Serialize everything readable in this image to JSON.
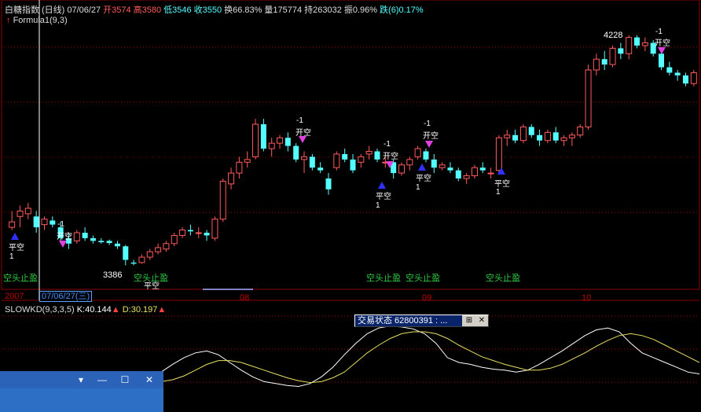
{
  "header": {
    "name": "白糖指数",
    "period": "(日线)",
    "date": "07/06/27",
    "open_label": "开",
    "open": "3574",
    "high_label": "高",
    "high": "3580",
    "low_label": "低",
    "low": "3546",
    "close_label": "收",
    "close": "3550",
    "turnover_label": "换",
    "turnover": "66.83%",
    "volume_label": "量",
    "volume": "175774",
    "oi_label": "持",
    "oi": "263032",
    "amp_label": "振",
    "amp": "0.96%",
    "chg_label": "跌(6)",
    "chg": "0.17%"
  },
  "formula": "Formula1(9,3)",
  "price_labels": {
    "high_mark": "4228",
    "low_mark": "3386"
  },
  "x_axis": {
    "labels": [
      "2007",
      "08",
      "09",
      "10"
    ],
    "current_date": "07/06/27(三)"
  },
  "signals": [
    {
      "type": "open_short",
      "label": "开空",
      "value": "-1"
    },
    {
      "type": "open_short",
      "label": "开空",
      "value": "-1"
    },
    {
      "type": "open_short",
      "label": "开空",
      "value": "-1"
    },
    {
      "type": "open_short",
      "label": "开空",
      "value": "-1"
    },
    {
      "type": "open_short",
      "label": "开空",
      "value": "-1"
    },
    {
      "type": "close_short",
      "label": "平空",
      "value": "1"
    },
    {
      "type": "close_short",
      "label": "平空",
      "value": "1"
    },
    {
      "type": "close_short",
      "label": "平空",
      "value": "1"
    },
    {
      "type": "close_short",
      "label": "平空",
      "value": "1"
    },
    {
      "type": "close_short",
      "label": "平空",
      "value": "1"
    }
  ],
  "stop_labels": [
    "空头止盈",
    "空头止盈",
    "空头止盈",
    "空头止盈",
    "空头止盈",
    "空头止盈"
  ],
  "kd": {
    "title": "SLOWKD(9,3,3,5)",
    "k_label": "K:40.144",
    "d_label": "D:30.197"
  },
  "trade_panel": {
    "title": "交易状态 62800391 : ...",
    "pin": "⊞",
    "close": "✕"
  },
  "mini_window": {
    "buttons": [
      "▾",
      "—",
      "☐",
      "✕"
    ]
  },
  "colors": {
    "up": "#ff5a5a",
    "down": "#54ffff",
    "ma": "#ffffff",
    "k": "#ffffff",
    "d": "#e8e060",
    "grid": "#8b0000"
  },
  "chart_data": {
    "type": "candlestick",
    "y_range": [
      3300,
      4300
    ],
    "candles": [
      [
        3520,
        3580,
        3510,
        3540
      ],
      [
        3560,
        3600,
        3520,
        3580
      ],
      [
        3570,
        3610,
        3550,
        3590
      ],
      [
        3560,
        3580,
        3500,
        3520
      ],
      [
        3530,
        3560,
        3510,
        3550
      ],
      [
        3545,
        3560,
        3520,
        3530
      ],
      [
        3520,
        3540,
        3460,
        3480
      ],
      [
        3480,
        3500,
        3440,
        3460
      ],
      [
        3470,
        3510,
        3460,
        3500
      ],
      [
        3500,
        3520,
        3470,
        3480
      ],
      [
        3480,
        3490,
        3460,
        3470
      ],
      [
        3470,
        3480,
        3460,
        3465
      ],
      [
        3470,
        3475,
        3455,
        3462
      ],
      [
        3460,
        3470,
        3440,
        3450
      ],
      [
        3450,
        3455,
        3380,
        3400
      ],
      [
        3390,
        3400,
        3380,
        3386
      ],
      [
        3390,
        3420,
        3386,
        3410
      ],
      [
        3410,
        3440,
        3400,
        3430
      ],
      [
        3430,
        3460,
        3420,
        3445
      ],
      [
        3440,
        3470,
        3430,
        3460
      ],
      [
        3460,
        3500,
        3450,
        3490
      ],
      [
        3490,
        3520,
        3480,
        3510
      ],
      [
        3510,
        3530,
        3490,
        3505
      ],
      [
        3500,
        3520,
        3480,
        3500
      ],
      [
        3500,
        3510,
        3470,
        3490
      ],
      [
        3480,
        3560,
        3470,
        3550
      ],
      [
        3550,
        3700,
        3540,
        3690
      ],
      [
        3680,
        3740,
        3660,
        3720
      ],
      [
        3720,
        3780,
        3700,
        3760
      ],
      [
        3760,
        3800,
        3740,
        3770
      ],
      [
        3780,
        3920,
        3770,
        3900
      ],
      [
        3900,
        3920,
        3800,
        3810
      ],
      [
        3810,
        3850,
        3780,
        3830
      ],
      [
        3830,
        3860,
        3810,
        3850
      ],
      [
        3850,
        3870,
        3800,
        3820
      ],
      [
        3820,
        3830,
        3760,
        3770
      ],
      [
        3770,
        3800,
        3720,
        3780
      ],
      [
        3780,
        3790,
        3730,
        3740
      ],
      [
        3740,
        3760,
        3720,
        3730
      ],
      [
        3700,
        3720,
        3640,
        3660
      ],
      [
        3740,
        3800,
        3730,
        3790
      ],
      [
        3790,
        3810,
        3760,
        3770
      ],
      [
        3770,
        3790,
        3720,
        3730
      ],
      [
        3760,
        3790,
        3740,
        3780
      ],
      [
        3790,
        3820,
        3770,
        3800
      ],
      [
        3800,
        3810,
        3760,
        3770
      ],
      [
        3760,
        3780,
        3740,
        3760
      ],
      [
        3760,
        3770,
        3700,
        3720
      ],
      [
        3720,
        3760,
        3710,
        3750
      ],
      [
        3750,
        3780,
        3730,
        3770
      ],
      [
        3780,
        3820,
        3770,
        3810
      ],
      [
        3800,
        3810,
        3760,
        3770
      ],
      [
        3770,
        3790,
        3720,
        3740
      ],
      [
        3740,
        3760,
        3730,
        3750
      ],
      [
        3740,
        3760,
        3720,
        3730
      ],
      [
        3730,
        3740,
        3690,
        3700
      ],
      [
        3700,
        3720,
        3680,
        3710
      ],
      [
        3710,
        3750,
        3700,
        3740
      ],
      [
        3740,
        3760,
        3720,
        3730
      ],
      [
        3720,
        3740,
        3700,
        3720
      ],
      [
        3730,
        3860,
        3720,
        3850
      ],
      [
        3850,
        3880,
        3820,
        3860
      ],
      [
        3860,
        3880,
        3830,
        3840
      ],
      [
        3840,
        3900,
        3830,
        3890
      ],
      [
        3890,
        3900,
        3850,
        3860
      ],
      [
        3860,
        3880,
        3820,
        3840
      ],
      [
        3840,
        3880,
        3830,
        3870
      ],
      [
        3870,
        3890,
        3830,
        3840
      ],
      [
        3840,
        3860,
        3820,
        3850
      ],
      [
        3850,
        3870,
        3820,
        3860
      ],
      [
        3860,
        3900,
        3850,
        3890
      ],
      [
        3890,
        4120,
        3880,
        4100
      ],
      [
        4100,
        4160,
        4080,
        4140
      ],
      [
        4140,
        4170,
        4100,
        4120
      ],
      [
        4120,
        4190,
        4110,
        4180
      ],
      [
        4180,
        4200,
        4140,
        4160
      ],
      [
        4160,
        4228,
        4140,
        4220
      ],
      [
        4220,
        4228,
        4180,
        4190
      ],
      [
        4190,
        4220,
        4170,
        4200
      ],
      [
        4200,
        4210,
        4150,
        4160
      ],
      [
        4160,
        4180,
        4100,
        4110
      ],
      [
        4110,
        4130,
        4080,
        4090
      ],
      [
        4090,
        4100,
        4060,
        4080
      ],
      [
        4080,
        4090,
        4040,
        4050
      ],
      [
        4050,
        4100,
        4040,
        4090
      ]
    ],
    "kd_k": [
      40,
      48,
      55,
      60,
      62,
      58,
      50,
      42,
      35,
      30,
      28,
      26,
      25,
      28,
      35,
      45,
      58,
      70,
      80,
      86,
      88,
      87,
      85,
      80,
      70,
      55,
      50,
      48,
      45,
      43,
      42,
      40,
      42,
      48,
      55,
      62,
      70,
      78,
      84,
      86,
      82,
      70,
      60,
      55,
      50,
      45,
      40,
      38
    ],
    "kd_d": [
      30,
      32,
      36,
      42,
      48,
      52,
      52,
      50,
      46,
      42,
      38,
      34,
      31,
      29,
      30,
      34,
      40,
      50,
      60,
      68,
      75,
      80,
      82,
      82,
      80,
      75,
      68,
      62,
      56,
      52,
      48,
      45,
      42,
      42,
      44,
      48,
      54,
      60,
      67,
      73,
      78,
      80,
      78,
      74,
      68,
      62,
      56,
      50
    ]
  }
}
